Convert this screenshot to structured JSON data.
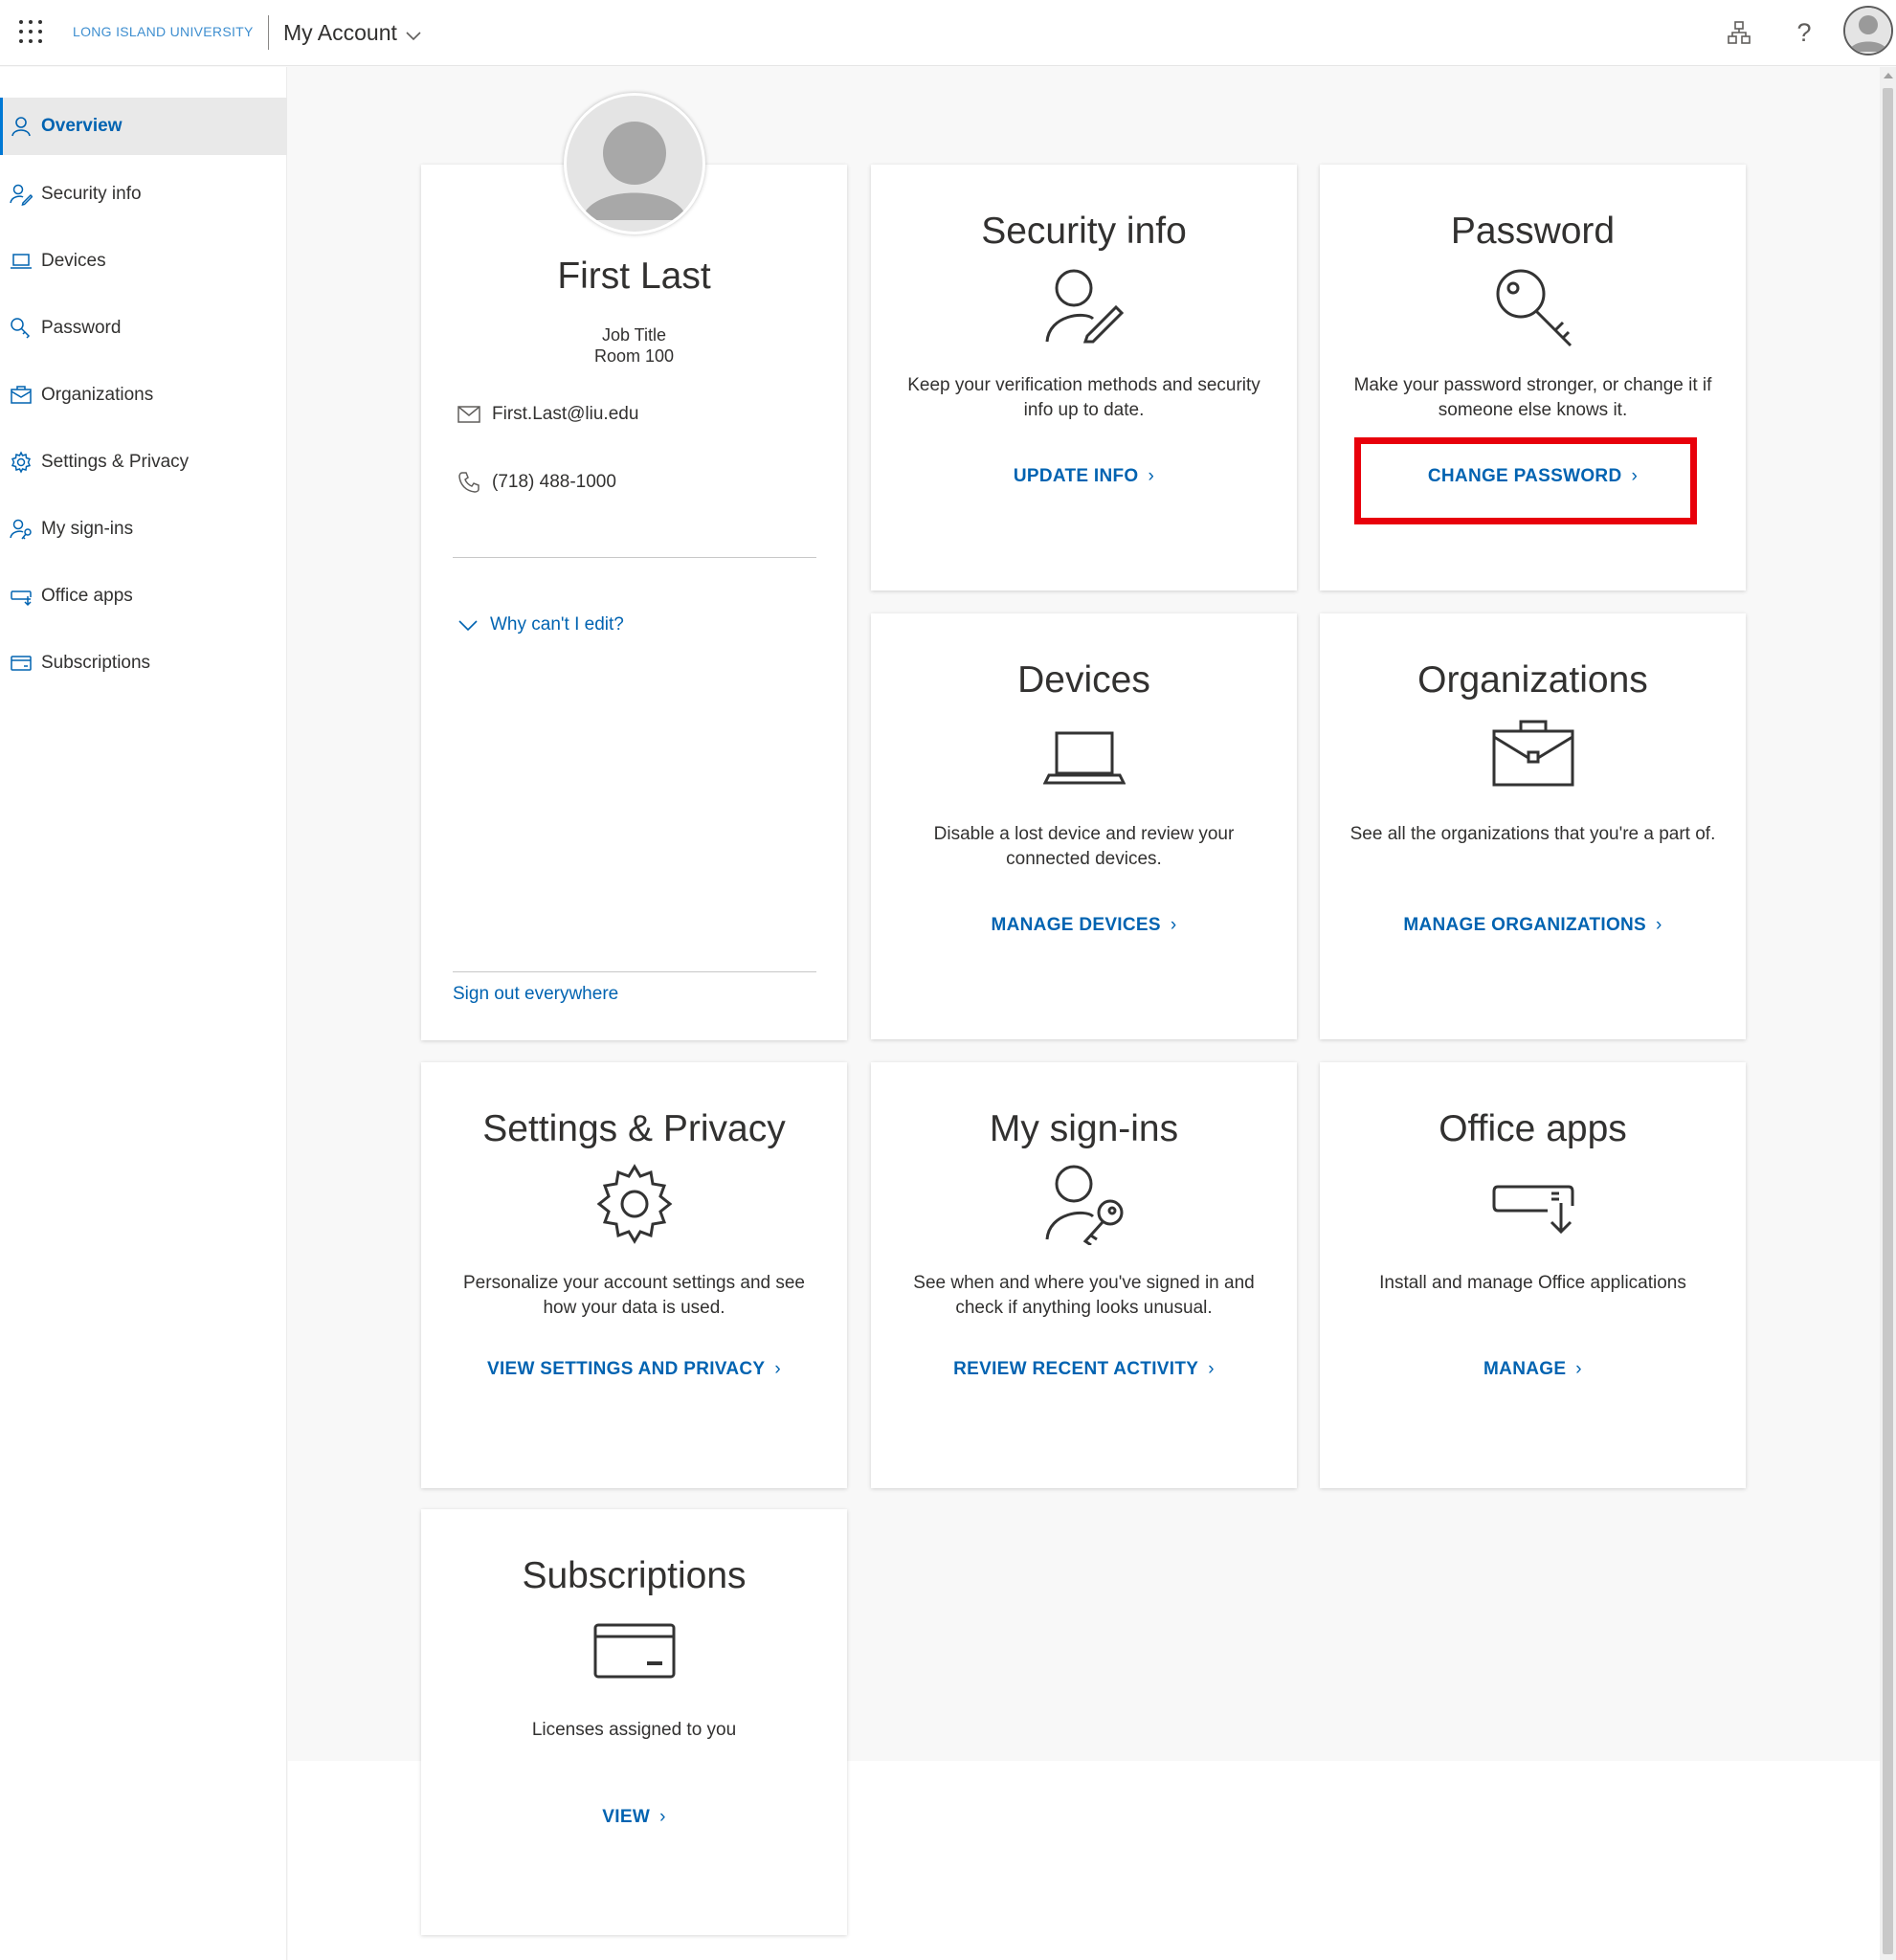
{
  "header": {
    "brand": "LONG ISLAND UNIVERSITY",
    "app_title": "My Account",
    "help_label": "?"
  },
  "sidebar": {
    "items": [
      {
        "label": "Overview",
        "icon": "person-icon",
        "active": true
      },
      {
        "label": "Security info",
        "icon": "person-edit-icon"
      },
      {
        "label": "Devices",
        "icon": "laptop-icon"
      },
      {
        "label": "Password",
        "icon": "key-icon"
      },
      {
        "label": "Organizations",
        "icon": "briefcase-icon"
      },
      {
        "label": "Settings & Privacy",
        "icon": "gear-icon"
      },
      {
        "label": "My sign-ins",
        "icon": "person-key-icon"
      },
      {
        "label": "Office apps",
        "icon": "office-apps-icon"
      },
      {
        "label": "Subscriptions",
        "icon": "card-icon"
      }
    ]
  },
  "profile": {
    "name": "First Last",
    "job_title": "Job Title",
    "room": "Room 100",
    "email": "First.Last@liu.edu",
    "phone": "(718) 488-1000",
    "why_cant_edit": "Why can't I edit?",
    "sign_out": "Sign out everywhere"
  },
  "cards": {
    "security": {
      "title": "Security info",
      "desc": "Keep your verification methods and security info up to date.",
      "link": "UPDATE INFO"
    },
    "password": {
      "title": "Password",
      "desc": "Make your password stronger, or change it if someone else knows it.",
      "link": "CHANGE PASSWORD"
    },
    "devices": {
      "title": "Devices",
      "desc": "Disable a lost device and review your connected devices.",
      "link": "MANAGE DEVICES"
    },
    "organizations": {
      "title": "Organizations",
      "desc": "See all the organizations that you're a part of.",
      "link": "MANAGE ORGANIZATIONS"
    },
    "settings": {
      "title": "Settings & Privacy",
      "desc": "Personalize your account settings and see how your data is used.",
      "link": "VIEW SETTINGS AND PRIVACY"
    },
    "signins": {
      "title": "My sign-ins",
      "desc": "See when and where you've signed in and check if anything looks unusual.",
      "link": "REVIEW RECENT ACTIVITY"
    },
    "office": {
      "title": "Office apps",
      "desc": "Install and manage Office applications",
      "link": "MANAGE"
    },
    "subscriptions": {
      "title": "Subscriptions",
      "desc": "Licenses assigned to you",
      "link": "VIEW"
    }
  },
  "colors": {
    "accent": "#0063b1",
    "highlight": "#e8000b",
    "active_nav_bg": "#e9e9e9"
  }
}
